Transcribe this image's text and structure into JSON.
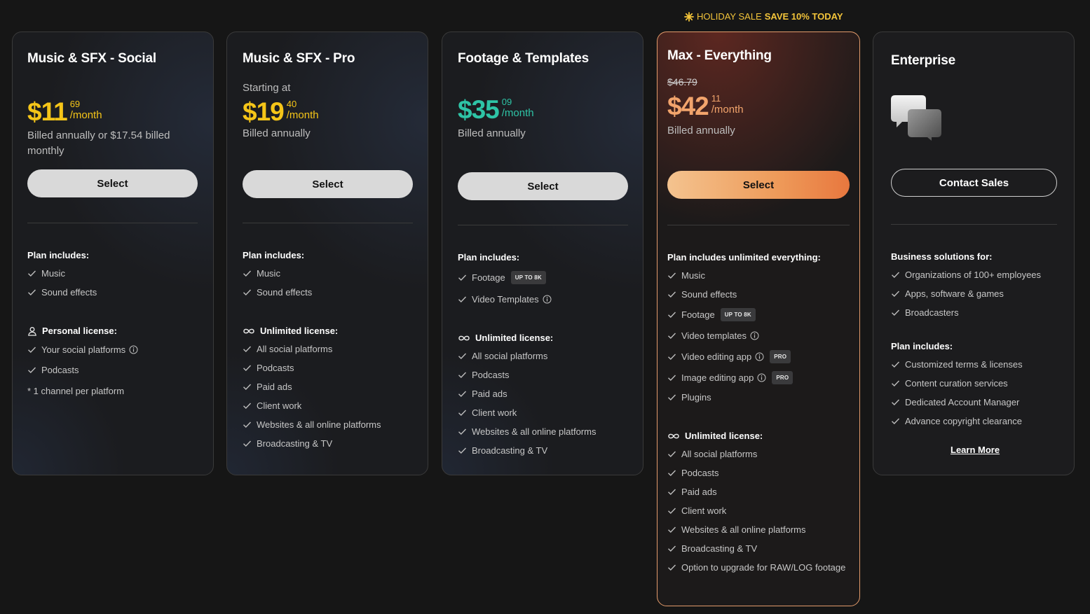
{
  "banner": {
    "label": "HOLIDAY SALE",
    "highlight": "SAVE 10% TODAY",
    "icon": "sparkle-icon"
  },
  "colors": {
    "yellow": "#f5c518",
    "teal": "#2ec4a6",
    "orange": "#f2a46c",
    "max_border": "#e39b6b"
  },
  "plans": {
    "social": {
      "title": "Music & SFX - Social",
      "price_main": "$11",
      "price_cents": "69",
      "per": "/month",
      "billed": "Billed annually or $17.54 billed monthly",
      "select": "Select",
      "includes_head": "Plan includes:",
      "includes": [
        "Music",
        "Sound effects"
      ],
      "license_head": "Personal license:",
      "license": [
        "Your social platforms",
        "Podcasts"
      ],
      "note": "* 1 channel per platform"
    },
    "pro": {
      "title": "Music & SFX - Pro",
      "starting": "Starting at",
      "price_main": "$19",
      "price_cents": "40",
      "per": "/month",
      "billed": "Billed annually",
      "select": "Select",
      "includes_head": "Plan includes:",
      "includes": [
        "Music",
        "Sound effects"
      ],
      "license_head": "Unlimited license:",
      "license": [
        "All social platforms",
        "Podcasts",
        "Paid ads",
        "Client work",
        "Websites & all online platforms",
        "Broadcasting & TV"
      ]
    },
    "footage": {
      "title": "Footage & Templates",
      "price_main": "$35",
      "price_cents": "09",
      "per": "/month",
      "billed": "Billed annually",
      "select": "Select",
      "includes_head": "Plan includes:",
      "includes": [
        "Footage",
        "Video Templates"
      ],
      "footage_tag": "UP TO 8K",
      "license_head": "Unlimited license:",
      "license": [
        "All social platforms",
        "Podcasts",
        "Paid ads",
        "Client work",
        "Websites & all online platforms",
        "Broadcasting & TV"
      ]
    },
    "max": {
      "title": "Max - Everything",
      "old_price": "$46.79",
      "price_main": "$42",
      "price_cents": "11",
      "per": "/month",
      "billed": "Billed annually",
      "select": "Select",
      "includes_head": "Plan includes unlimited everything:",
      "includes": [
        "Music",
        "Sound effects",
        "Footage",
        "Video templates",
        "Video editing app",
        "Image editing app",
        "Plugins"
      ],
      "footage_tag": "UP TO 8K",
      "pro_tag": "PRO",
      "license_head": "Unlimited license:",
      "license": [
        "All social platforms",
        "Podcasts",
        "Paid ads",
        "Client work",
        "Websites & all online platforms",
        "Broadcasting & TV",
        "Option to upgrade for RAW/LOG footage"
      ]
    },
    "enterprise": {
      "title": "Enterprise",
      "icon": "chat-bubbles-icon",
      "contact": "Contact Sales",
      "business_head": "Business solutions for:",
      "business": [
        "Organizations of 100+ employees",
        "Apps, software & games",
        "Broadcasters"
      ],
      "includes_head": "Plan includes:",
      "includes": [
        "Customized terms & licenses",
        "Content curation services",
        "Dedicated Account Manager",
        "Advance copyright clearance"
      ],
      "learn_more": "Learn More"
    }
  }
}
